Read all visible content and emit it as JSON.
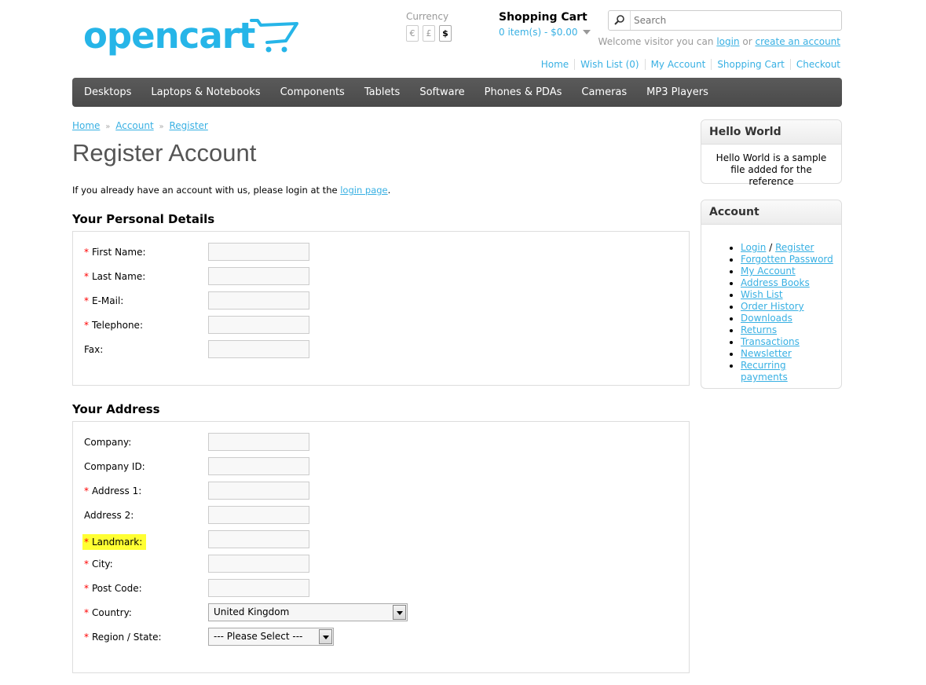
{
  "header": {
    "logo_text": "opencart",
    "currency": {
      "title": "Currency",
      "options": [
        "€",
        "£",
        "$"
      ],
      "selected": "$"
    },
    "cart": {
      "title": "Shopping Cart",
      "total": "0 item(s) - $0.00"
    },
    "search": {
      "placeholder": "Search"
    },
    "welcome": {
      "prefix": "Welcome visitor you can",
      "login": "login",
      "or": "or",
      "create": "create an account"
    },
    "links": [
      "Home",
      "Wish List (0)",
      "My Account",
      "Shopping Cart",
      "Checkout"
    ]
  },
  "menu": [
    "Desktops",
    "Laptops & Notebooks",
    "Components",
    "Tablets",
    "Software",
    "Phones & PDAs",
    "Cameras",
    "MP3 Players"
  ],
  "breadcrumb": [
    "Home",
    "Account",
    "Register"
  ],
  "breadcrumb_sep": "»",
  "page_title": "Register Account",
  "intro": {
    "text": "If you already have an account with us, please login at the",
    "link": "login page",
    "end": "."
  },
  "personal": {
    "title": "Your Personal Details",
    "fields": [
      {
        "label": "First Name:",
        "required": "*"
      },
      {
        "label": "Last Name:",
        "required": "*"
      },
      {
        "label": "E-Mail:",
        "required": "*"
      },
      {
        "label": "Telephone:",
        "required": "*"
      },
      {
        "label": "Fax:",
        "required": ""
      }
    ]
  },
  "address": {
    "title": "Your Address",
    "fields": [
      {
        "label": "Company:",
        "required": ""
      },
      {
        "label": "Company ID:",
        "required": ""
      },
      {
        "label": "Address 1:",
        "required": "*"
      },
      {
        "label": "Address 2:",
        "required": ""
      },
      {
        "label": "Landmark:",
        "required": "*"
      },
      {
        "label": "City:",
        "required": "*"
      },
      {
        "label": "Post Code:",
        "required": "*"
      },
      {
        "label": "Country:",
        "required": "*",
        "value": "United Kingdom"
      },
      {
        "label": "Region / State:",
        "required": "*",
        "value": "--- Please Select ---"
      }
    ],
    "highlight_color": "#FFFF33"
  },
  "sidebar": {
    "hello": {
      "title": "Hello World",
      "text": "Hello World is a sample file added for the reference"
    },
    "account": {
      "title": "Account",
      "login": "Login",
      "slash": "/",
      "register": "Register",
      "items": [
        "Forgotten Password",
        "My Account",
        "Address Books",
        "Wish List",
        "Order History",
        "Downloads",
        "Returns",
        "Transactions",
        "Newsletter",
        "Recurring payments"
      ]
    }
  },
  "colors": {
    "link": "#38B0E3",
    "menu_bg": "#555555",
    "required": "#FF0000",
    "logo": "#26B5E8"
  }
}
